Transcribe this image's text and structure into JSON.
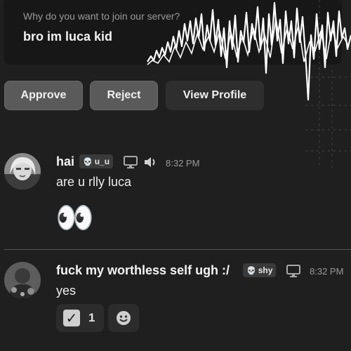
{
  "application": {
    "question": "Why do you want to join our server?",
    "answer": "bro im luca kid"
  },
  "actions": {
    "approve": "Approve",
    "reject": "Reject",
    "view_profile": "View Profile"
  },
  "messages": [
    {
      "username": "hai",
      "tag": "u_u",
      "time": "8:32 PM",
      "text": "are u rlly luca",
      "emoji": "👀"
    },
    {
      "username": "fuck my worthless self ugh :/",
      "tag": "shy",
      "time": "8:32 PM",
      "text": "yes",
      "reactions": [
        {
          "icon": "check-mark-icon",
          "count": "1"
        }
      ]
    }
  ],
  "colors": {
    "background": "#1f1f1f",
    "card": "#171717",
    "button_secondary": "#5a5a5a",
    "text_muted": "#9a9a9a"
  }
}
